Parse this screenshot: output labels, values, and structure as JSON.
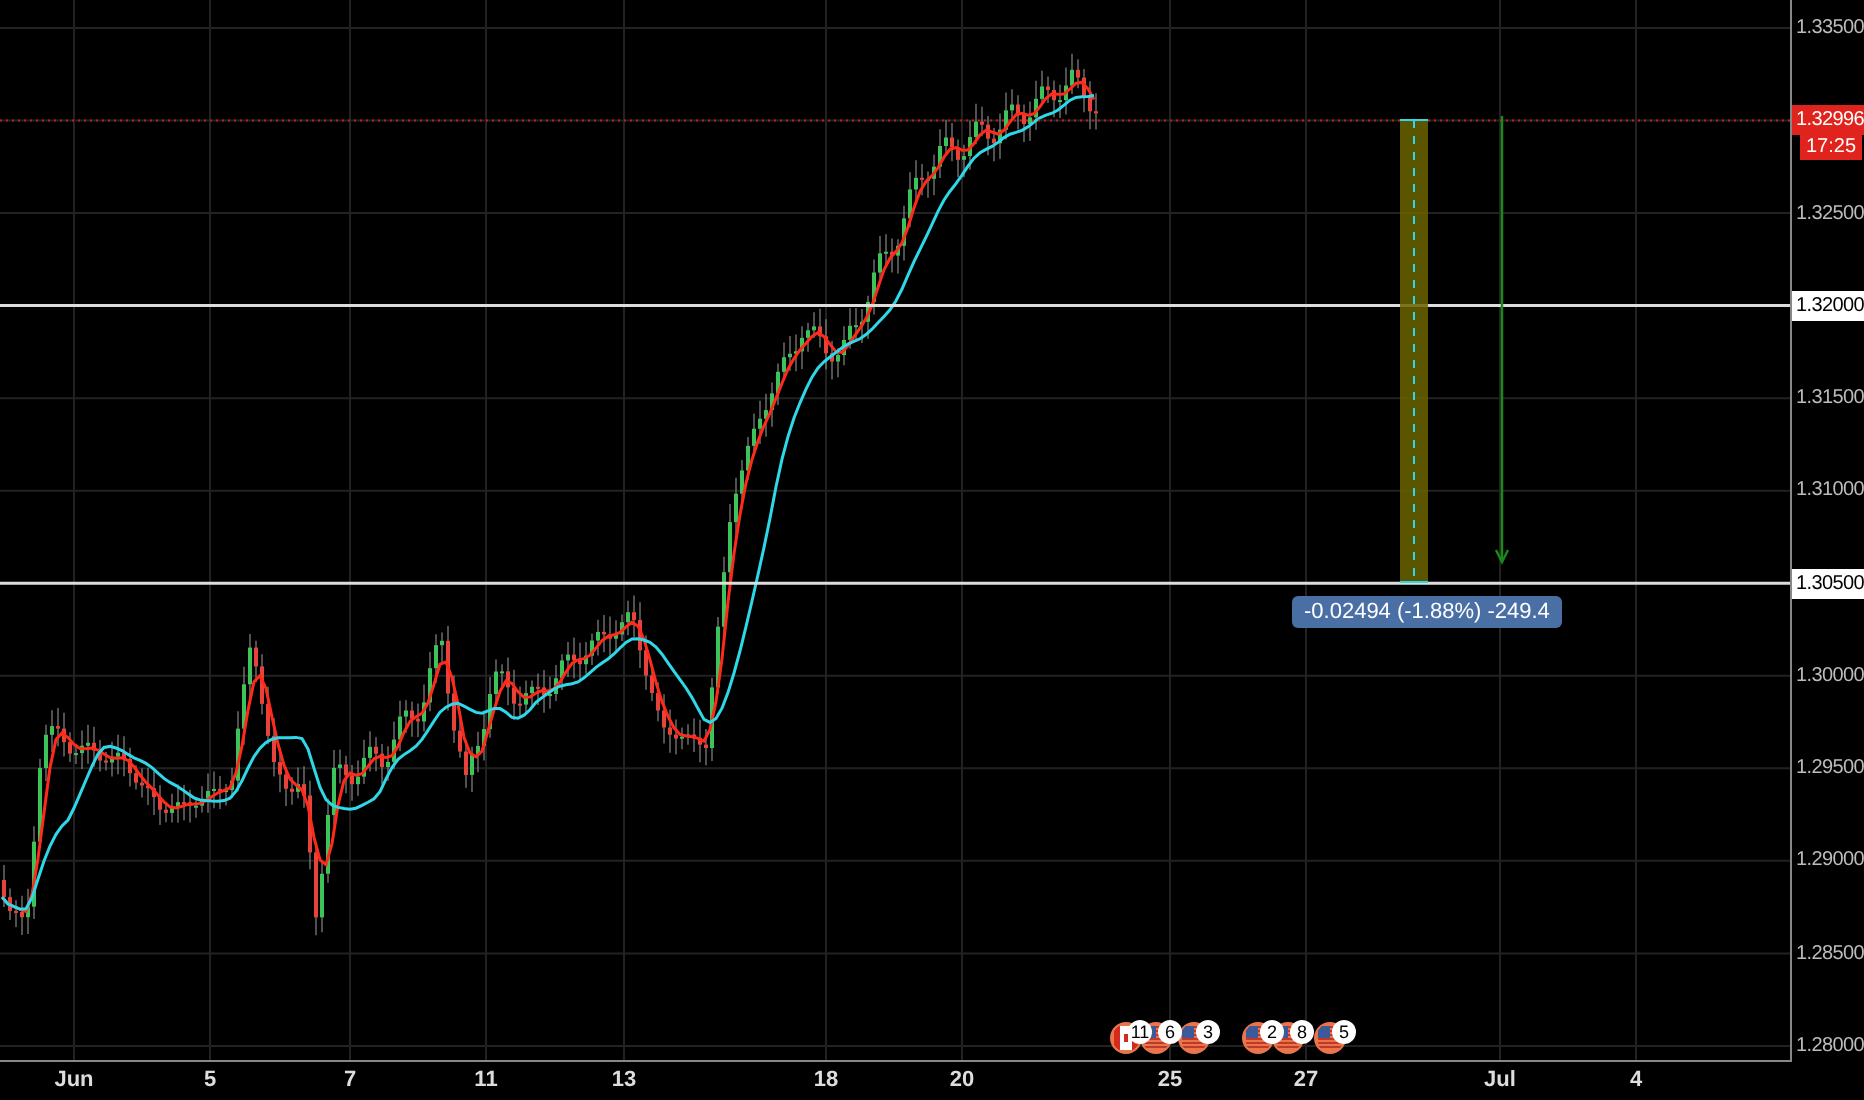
{
  "price_axis": [
    {
      "label": "1.33500",
      "kind": "tick"
    },
    {
      "label": "1.32996",
      "kind": "current"
    },
    {
      "label": "1.32500",
      "kind": "tick"
    },
    {
      "label": "1.32000",
      "kind": "level"
    },
    {
      "label": "1.31500",
      "kind": "tick"
    },
    {
      "label": "1.31000",
      "kind": "tick"
    },
    {
      "label": "1.30500",
      "kind": "level"
    },
    {
      "label": "1.30000",
      "kind": "tick"
    },
    {
      "label": "1.29500",
      "kind": "tick"
    },
    {
      "label": "1.29000",
      "kind": "tick"
    },
    {
      "label": "1.28500",
      "kind": "tick"
    },
    {
      "label": "1.28000",
      "kind": "tick"
    }
  ],
  "countdown": "17:25",
  "time_axis": [
    "Jun",
    "5",
    "7",
    "11",
    "13",
    "18",
    "20",
    "25",
    "27",
    "Jul",
    "4"
  ],
  "measurement": {
    "label": "-0.02494 (-1.88%) -249.4"
  },
  "events": [
    {
      "kind": "ca",
      "count": "11"
    },
    {
      "kind": "us",
      "count": "6"
    },
    {
      "kind": "us",
      "count": "3"
    },
    {
      "kind": "us",
      "count": "2"
    },
    {
      "kind": "us",
      "count": "8"
    },
    {
      "kind": "us",
      "count": "5"
    }
  ]
}
